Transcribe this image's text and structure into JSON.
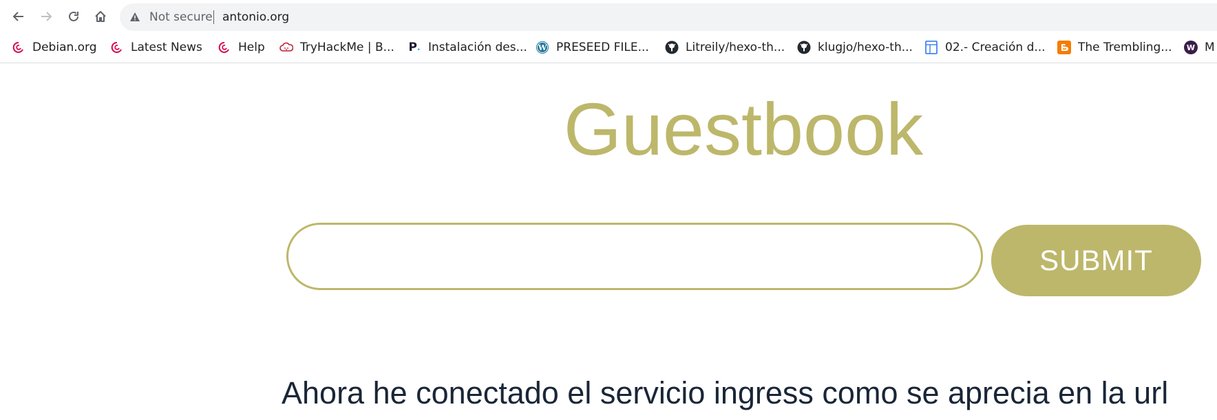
{
  "browser": {
    "security_status": "Not secure",
    "url": "antonio.org",
    "icons": [
      "back-arrow-icon",
      "forward-arrow-icon",
      "reload-icon",
      "home-icon",
      "warning-icon"
    ]
  },
  "bookmarks": [
    {
      "label": "Debian.org",
      "icon": "debian-icon"
    },
    {
      "label": "Latest News",
      "icon": "debian-icon"
    },
    {
      "label": "Help",
      "icon": "debian-icon"
    },
    {
      "label": "TryHackMe | B...",
      "icon": "tryhackme-cloud-icon"
    },
    {
      "label": "Instalación des...",
      "icon": "p-logo-icon"
    },
    {
      "label": "PRESEED FILE...",
      "icon": "wordpress-icon"
    },
    {
      "label": "Litreily/hexo-th...",
      "icon": "github-icon"
    },
    {
      "label": "klugjo/hexo-th...",
      "icon": "github-icon"
    },
    {
      "label": "02.- Creación d...",
      "icon": "document-icon"
    },
    {
      "label": "The Trembling...",
      "icon": "blogger-icon"
    },
    {
      "label": "M",
      "icon": "w-circle-icon"
    }
  ],
  "page": {
    "title": "Guestbook",
    "input_value": "",
    "submit_label": "SUBMIT",
    "message": "Ahora he conectado el servicio ingress como se aprecia en la url"
  },
  "colors": {
    "accent": "#bdb76b",
    "message_text": "#1a2637",
    "debian_red": "#d70751",
    "github_black": "#24292e",
    "wordpress_blue": "#21759b",
    "blogger_orange": "#f57d00",
    "docs_blue": "#4285f4"
  }
}
